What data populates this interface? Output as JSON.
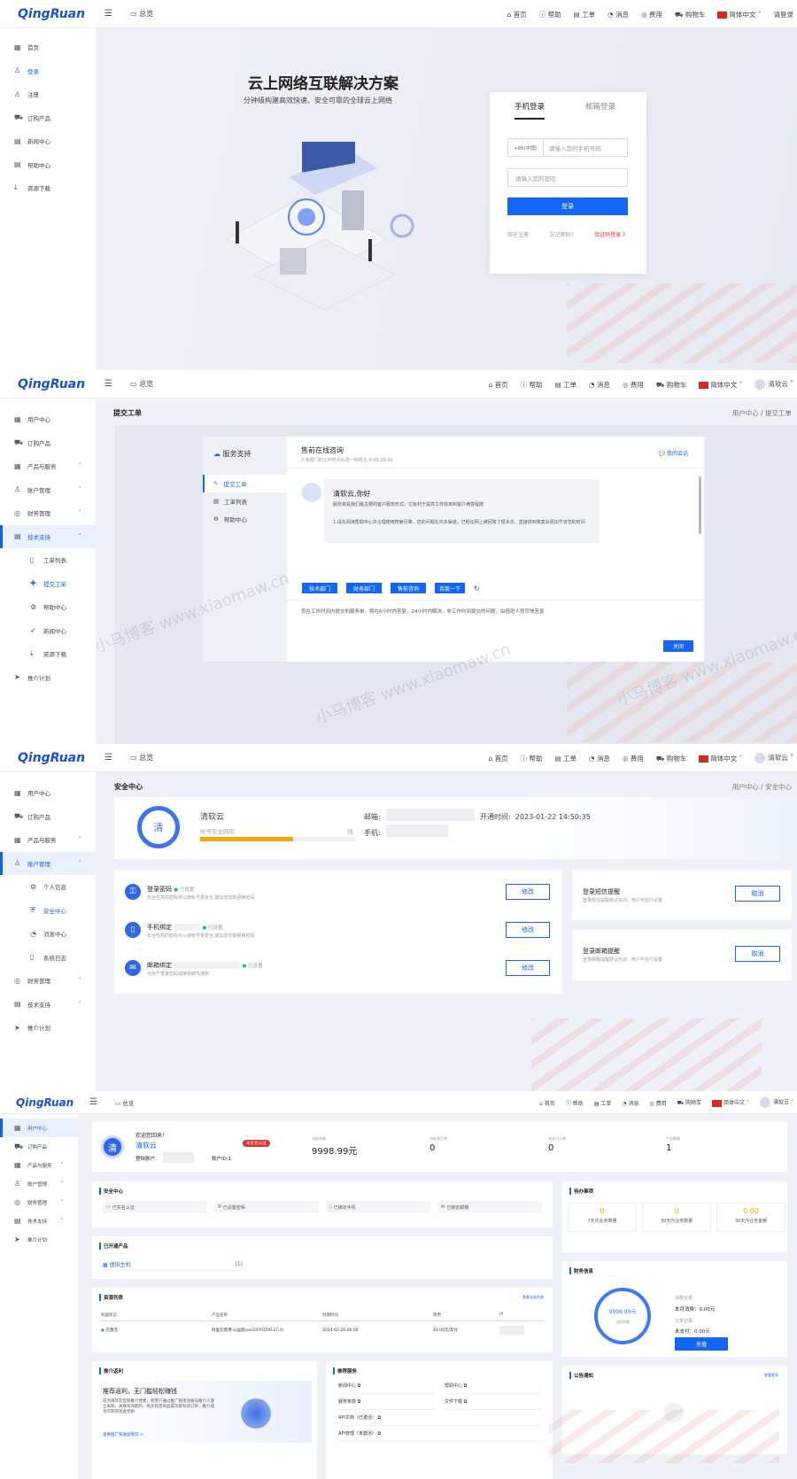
{
  "brand": {
    "logo": "QingRuan",
    "overview": "总览"
  },
  "nav1": {
    "items": [
      "首页",
      "帮助",
      "工单",
      "消息",
      "费用",
      "购物车"
    ],
    "lang": "简体中文",
    "login": "请登录"
  },
  "nav_user": {
    "items": [
      "首页",
      "帮助",
      "工单",
      "消息",
      "费用",
      "购物车"
    ],
    "lang": "简体中文",
    "user": "清软云"
  },
  "s1": {
    "sidebar": [
      "首页",
      "登录",
      "注册",
      "订购产品",
      "新闻中心",
      "帮助中心",
      "资源下载"
    ],
    "hero_title": "云上网络互联解决方案",
    "hero_sub": "分钟级构建高效快速、安全可靠的全球云上网络",
    "tab_phone": "手机登录",
    "tab_email": "邮箱登录",
    "area_code": "+86(中国)",
    "phone_ph": "请输入您的手机号码",
    "pwd_ph": "请输入您的密码",
    "login_btn": "登录",
    "reg": "现在注册",
    "forgot": "忘记密码?",
    "code_login": "验证码登录 》"
  },
  "s2": {
    "sidebar": [
      "用户中心",
      "订购产品",
      "产品与服务",
      "账户管理",
      "财务管理",
      "技术支持",
      "工单列表",
      "提交工单",
      "帮助中心",
      "新闻中心",
      "资源下载",
      "推介计划"
    ],
    "title": "提交工单",
    "crumb": "用户中心  /  提交工单",
    "panel_title": "服务支持",
    "panel_menu": [
      "提交工单",
      "工单列表",
      "帮助中心"
    ],
    "chat_title": "售前在线咨询",
    "chat_sub": "3 条部门的工作时间为周一到周五 9:00-18:00",
    "my_chat": "我的会话",
    "greet": "清软云,你好",
    "greet_desc": "服务单是我们最主要的客户服务形式，它有利于提高工作效率和客户满意程度",
    "greet_note": "1.请先阅读帮助中心并合理使用搜索引擎，您的问题在许多渠道，已经在网上被回答了很多次。直接找到答案会更加节省您的时间",
    "dept_btns": [
      "技术部门",
      "财务部门",
      "售前咨询",
      "百度一下"
    ],
    "notice": "您在工作时间内提交的服务单，将在6小时内答复，24小时内解决。非工作时间提交的问题，由值班人员尽快答复",
    "close": "关闭",
    "watermark": "小马博客 www.xiaomaw.cn"
  },
  "s3": {
    "sidebar": [
      "用户中心",
      "订购产品",
      "产品与服务",
      "账户管理",
      "个人信息",
      "安全中心",
      "消息中心",
      "系统日志",
      "财务管理",
      "技术支持",
      "推介计划"
    ],
    "title": "安全中心",
    "crumb": "用户中心  /  安全中心",
    "avatar_char": "清",
    "name": "清软云",
    "strength_label": "账号安全强度",
    "strength_val": "强",
    "strength": 0.6,
    "email_label": "邮箱:",
    "phone_label": "手机:",
    "open_label": "开通时间:",
    "open_time": "2023-01-22 14:50:35",
    "rows": [
      {
        "title": "登录密码",
        "status": "已设置",
        "desc": "安全性高的密码可以使帐号更安全,建议您定期更换密码",
        "btn": "修改"
      },
      {
        "title": "手机绑定",
        "status": "已设置",
        "desc": "安全性高的密码可以使帐号更安全,建议您定期更换密码",
        "btn": "修改"
      },
      {
        "title": "邮箱绑定",
        "status": "已设置",
        "desc": "可用于重置密码或接受邮件通知",
        "btn": "修改"
      }
    ],
    "alerts": [
      {
        "title": "登录短信提醒",
        "desc": "登录短信提醒默认关闭，用户可自行设置",
        "btn": "取消"
      },
      {
        "title": "登录邮箱提醒",
        "desc": "登录邮箱提醒默认开启，用户可自行设置",
        "btn": "取消"
      }
    ]
  },
  "s4": {
    "sidebar": [
      "用户中心",
      "订购产品",
      "产品与服务",
      "账户管理",
      "财务管理",
      "技术支持",
      "推介计划"
    ],
    "welcome": "欢迎您回来！",
    "name": "清软云",
    "badge": "未实名认证",
    "login_acc": "登陆账户:",
    "acc_id": "账户ID:1",
    "stats": [
      {
        "label": "当前余额",
        "value": "9998.99元"
      },
      {
        "label": "待处理工单",
        "value": "0"
      },
      {
        "label": "未支付订单",
        "value": "0"
      },
      {
        "label": "产品数量",
        "value": "1"
      }
    ],
    "sec_title": "安全中心",
    "sec_items": [
      "已实名认证",
      "已设置密保",
      "已绑定手机",
      "已绑定邮箱"
    ],
    "todo_title": "待办事项",
    "todo": [
      {
        "value": "0",
        "label": "7天内业务数量"
      },
      {
        "value": "0",
        "label": "30天内业务数量"
      },
      {
        "value": "0.00",
        "label": "30天内业务金额"
      }
    ],
    "prod_title": "已开通产品",
    "prod_name": "虚拟主机",
    "prod_count": "(1)",
    "fin_title": "财务信息",
    "fin_amount": "9998.99元",
    "fin_sub": "当前余额",
    "fin_spend_label": "消费记录",
    "fin_spend": "本月消费：0.00元",
    "fin_order_label": "订单记录",
    "fin_order": "未支付：0.00元",
    "recharge": "充值",
    "res_title": "资源列表",
    "res_more": "查看全部资源",
    "res_cols": [
      "机器状态",
      "产品名称",
      "到期时间",
      "费用",
      "IP"
    ],
    "res_row": [
      "已激活",
      "阿里云香港-公益版(ser2470359137,4)",
      "2024-02-29 00:00",
      "40.00元/年付",
      ""
    ],
    "promo_title": "推介返利",
    "promo_head": "推荐返利，无门槛轻松赚钱",
    "promo_desc": "成为清软云互联推介使者，新客户通过推广链接注册与推介人建立关联，关联有效期内，购买指定商品成功即有效订单，推介成功可获得现金奖励",
    "promo_link": "查看推广和收益情况 >",
    "rec_title": "推荐服务",
    "rec_items": [
      "新闻中心",
      "帮助中心",
      "服务条款",
      "文件下载",
      "API文档（已激活）",
      "API管理（未激活）"
    ],
    "notice_title": "公告通知",
    "notice_more": "查看更多"
  }
}
